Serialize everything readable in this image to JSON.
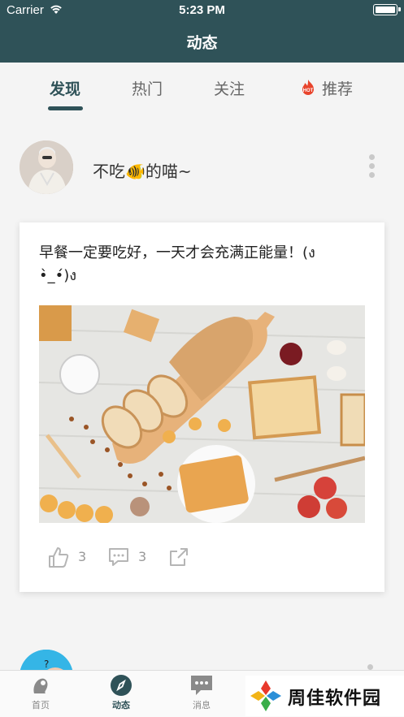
{
  "status_bar": {
    "carrier": "Carrier",
    "time": "5:23 PM"
  },
  "nav": {
    "title": "动态"
  },
  "tabs": [
    {
      "label": "发现",
      "active": true
    },
    {
      "label": "热门",
      "active": false
    },
    {
      "label": "关注",
      "active": false
    },
    {
      "label": "推荐",
      "active": false,
      "icon": "hot-fire-icon"
    }
  ],
  "post": {
    "username": "不吃🐠的喵~",
    "text": "早餐一定要吃好，一天才会充满正能量！(ง •̀_•́)ง",
    "likes": "3",
    "comments": "3",
    "like_icon": "thumbs-up-icon",
    "comment_icon": "comment-icon",
    "share_icon": "share-icon"
  },
  "tabbar": [
    {
      "label": "首页",
      "icon": "home-icon",
      "active": false
    },
    {
      "label": "动态",
      "icon": "compass-icon",
      "active": true
    },
    {
      "label": "消息",
      "icon": "message-icon",
      "active": false
    }
  ],
  "watermark": {
    "text": "周佳软件园"
  },
  "colors": {
    "header_bg": "#2f5258",
    "accent": "#2f5258",
    "page_bg": "#f4f4f4"
  }
}
